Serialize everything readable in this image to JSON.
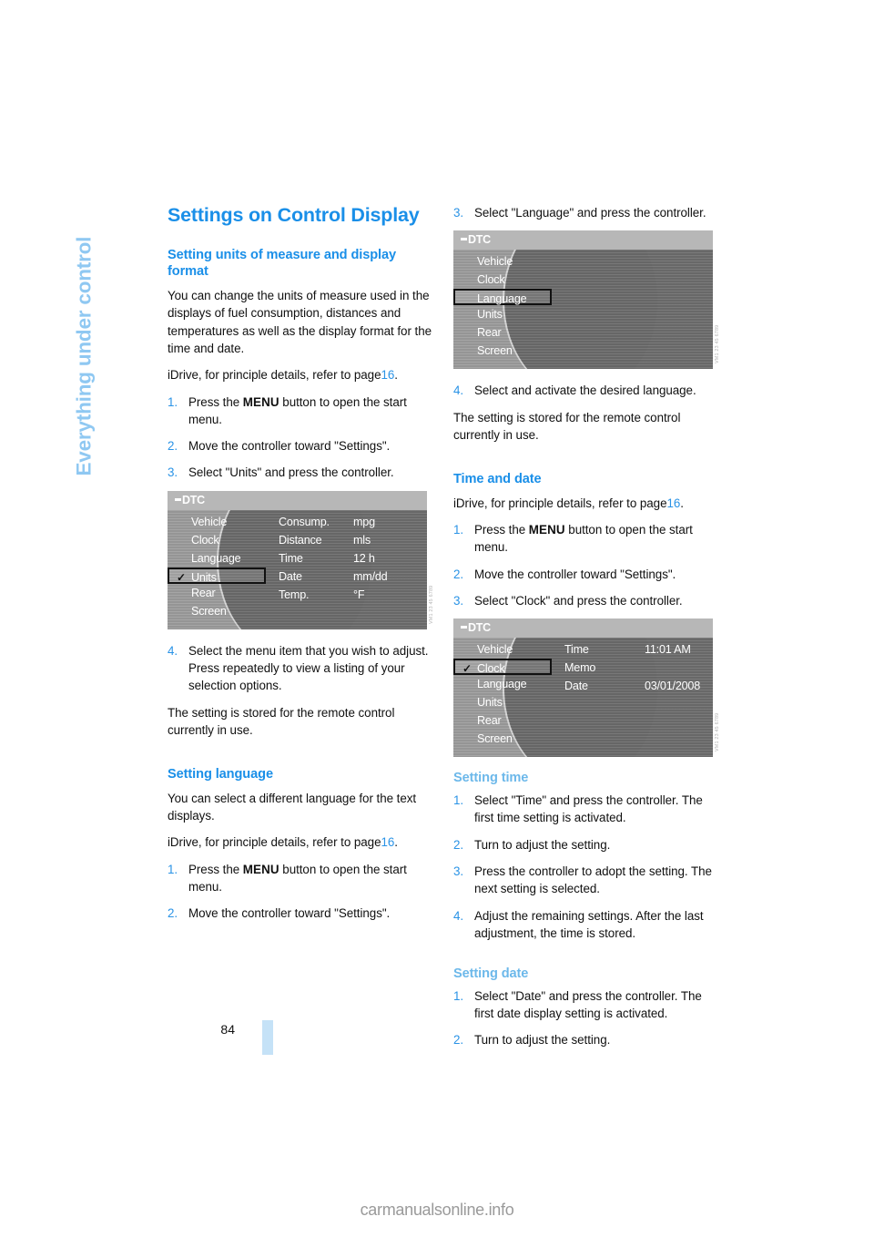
{
  "chapter_tab": {
    "label": "Everything under control"
  },
  "page": {
    "number": "84",
    "footer_watermark": "carmanualsonline.info"
  },
  "title": "Settings on Control Display",
  "left_column": {
    "heading_units": "Setting units of measure and display format",
    "intro": "You can change the units of measure used in the displays of fuel consumption, distances and temperatures as well as the display format for the time and date.",
    "idrive_ref_prefix": "iDrive, for principle details, refer to page",
    "idrive_ref_page": "16",
    "idrive_ref_suffix": ".",
    "steps_units": [
      {
        "num": "1.",
        "text_pre": "Press the ",
        "key": "MENU",
        "text_post": " button to open the start menu."
      },
      {
        "num": "2.",
        "text": "Move the controller toward \"Settings\"."
      },
      {
        "num": "3.",
        "text": "Select \"Units\" and press the controller."
      }
    ],
    "step4_units": {
      "num": "4.",
      "text": "Select the menu item that you wish to adjust. Press repeatedly to view a listing of your selection options."
    },
    "stored_note": "The setting is stored for the remote control currently in use.",
    "heading_language": "Setting language",
    "language_intro": "You can select a different language for the text displays.",
    "steps_language": [
      {
        "num": "1.",
        "text_pre": "Press the ",
        "key": "MENU",
        "text_post": " button to open the start menu."
      },
      {
        "num": "2.",
        "text": "Move the controller toward \"Settings\"."
      }
    ]
  },
  "right_column": {
    "step3_language": {
      "num": "3.",
      "text": "Select \"Language\" and press the controller."
    },
    "step4_language": {
      "num": "4.",
      "text": "Select and activate the desired language."
    },
    "stored_note": "The setting is stored for the remote control currently in use.",
    "heading_time_date": "Time and date",
    "idrive_ref_prefix": "iDrive, for principle details, refer to page",
    "idrive_ref_page": "16",
    "idrive_ref_suffix": ".",
    "steps_clock": [
      {
        "num": "1.",
        "text_pre": "Press the ",
        "key": "MENU",
        "text_post": " button to open the start menu."
      },
      {
        "num": "2.",
        "text": "Move the controller toward \"Settings\"."
      },
      {
        "num": "3.",
        "text": "Select \"Clock\" and press the controller."
      }
    ],
    "heading_setting_time": "Setting time",
    "steps_setting_time": [
      {
        "num": "1.",
        "text": "Select \"Time\" and press the controller. The first time setting is activated."
      },
      {
        "num": "2.",
        "text": "Turn to adjust the setting."
      },
      {
        "num": "3.",
        "text": "Press the controller to adopt the setting. The next setting is selected."
      },
      {
        "num": "4.",
        "text": "Adjust the remaining settings. After the last adjustment, the time is stored."
      }
    ],
    "heading_setting_date": "Setting date",
    "steps_setting_date": [
      {
        "num": "1.",
        "text": "Select \"Date\" and press the controller. The first date display setting is activated."
      },
      {
        "num": "2.",
        "text": "Turn to adjust the setting."
      }
    ]
  },
  "figures": {
    "units_screen": {
      "header": "DTC",
      "menu": [
        {
          "label": "Vehicle",
          "selected": false,
          "checked": false
        },
        {
          "label": "Clock",
          "selected": false,
          "checked": false
        },
        {
          "label": "Language",
          "selected": false,
          "checked": false
        },
        {
          "label": "Units",
          "selected": true,
          "checked": true
        },
        {
          "label": "Rear",
          "selected": false,
          "checked": false
        },
        {
          "label": "Screen",
          "selected": false,
          "checked": false
        }
      ],
      "rows": [
        {
          "label": "Consump.",
          "value": "mpg"
        },
        {
          "label": "Distance",
          "value": "mls"
        },
        {
          "label": "Time",
          "value": "12 h"
        },
        {
          "label": "Date",
          "value": "mm/dd"
        },
        {
          "label": "Temp.",
          "value": "°F"
        }
      ],
      "code": "VM1 23 45 6789"
    },
    "language_screen": {
      "header": "DTC",
      "menu": [
        {
          "label": "Vehicle",
          "selected": false,
          "checked": false
        },
        {
          "label": "Clock",
          "selected": false,
          "checked": false
        },
        {
          "label": "Language",
          "selected": true,
          "checked": false
        },
        {
          "label": "Units",
          "selected": false,
          "checked": false
        },
        {
          "label": "Rear",
          "selected": false,
          "checked": false
        },
        {
          "label": "Screen",
          "selected": false,
          "checked": false
        }
      ],
      "rows": [],
      "code": "VM1 23 45 6789"
    },
    "clock_screen": {
      "header": "DTC",
      "menu": [
        {
          "label": "Vehicle",
          "selected": false,
          "checked": false
        },
        {
          "label": "Clock",
          "selected": true,
          "checked": true
        },
        {
          "label": "Language",
          "selected": false,
          "checked": false
        },
        {
          "label": "Units",
          "selected": false,
          "checked": false
        },
        {
          "label": "Rear",
          "selected": false,
          "checked": false
        },
        {
          "label": "Screen",
          "selected": false,
          "checked": false
        }
      ],
      "rows": [
        {
          "label": "Time",
          "value": "11:01 AM"
        },
        {
          "label": "Memo",
          "value": ""
        },
        {
          "label": "Date",
          "value": "03/01/2008"
        }
      ],
      "code": "VM1 23 45 6789"
    }
  },
  "colors": {
    "accent_blue": "#1a8fe8",
    "light_blue": "#6cb8ea",
    "tab_blue": "#8fc8f2",
    "folio_bar": "#c5e2f7"
  }
}
